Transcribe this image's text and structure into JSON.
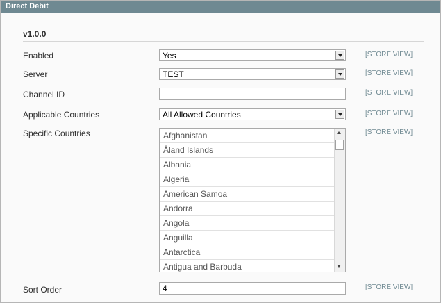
{
  "section": {
    "title": "Direct Debit",
    "version": "v1.0.0"
  },
  "fields": {
    "enabled": {
      "label": "Enabled",
      "value": "Yes",
      "scope": "[STORE VIEW]"
    },
    "server": {
      "label": "Server",
      "value": "TEST",
      "scope": "[STORE VIEW]"
    },
    "channel_id": {
      "label": "Channel ID",
      "value": "",
      "scope": "[STORE VIEW]"
    },
    "applicable_countries": {
      "label": "Applicable Countries",
      "value": "All Allowed Countries",
      "scope": "[STORE VIEW]"
    },
    "specific_countries": {
      "label": "Specific Countries",
      "scope": "[STORE VIEW]",
      "options": [
        "Afghanistan",
        "Åland Islands",
        "Albania",
        "Algeria",
        "American Samoa",
        "Andorra",
        "Angola",
        "Anguilla",
        "Antarctica",
        "Antigua and Barbuda"
      ]
    },
    "sort_order": {
      "label": "Sort Order",
      "value": "4",
      "scope": "[STORE VIEW]"
    }
  }
}
